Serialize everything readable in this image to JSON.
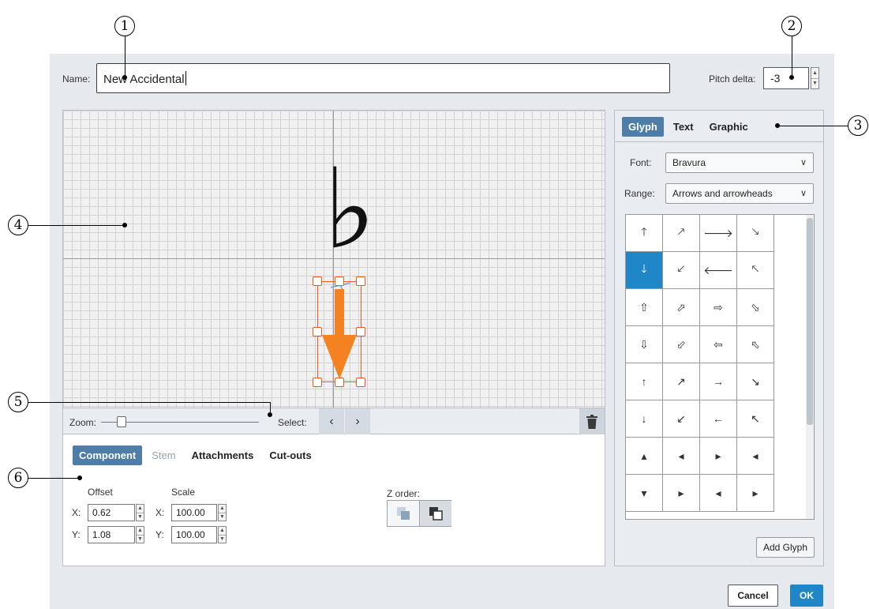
{
  "callouts": [
    "1",
    "2",
    "3",
    "4",
    "5",
    "6"
  ],
  "header": {
    "name_label": "Name:",
    "name_value": "New Accidental",
    "pitch_label": "Pitch delta:",
    "pitch_value": "-3"
  },
  "canvas": {
    "glyph": "♭"
  },
  "zoom_bar": {
    "zoom_label": "Zoom:",
    "select_label": "Select:",
    "prev": "‹",
    "next": "›",
    "trash_icon": "trash-icon"
  },
  "component_tabs": [
    {
      "label": "Component",
      "state": "active"
    },
    {
      "label": "Stem",
      "state": "disabled"
    },
    {
      "label": "Attachments",
      "state": "normal"
    },
    {
      "label": "Cut-outs",
      "state": "normal"
    }
  ],
  "properties": {
    "offset_label": "Offset",
    "scale_label": "Scale",
    "x_label": "X:",
    "y_label": "Y:",
    "offset_x": "0.62",
    "offset_y": "1.08",
    "scale_x": "100.00",
    "scale_y": "100.00",
    "zorder_label": "Z order:"
  },
  "right_tabs": [
    {
      "label": "Glyph",
      "state": "active"
    },
    {
      "label": "Text",
      "state": "normal"
    },
    {
      "label": "Graphic",
      "state": "normal"
    }
  ],
  "font": {
    "label": "Font:",
    "value": "Bravura"
  },
  "range": {
    "label": "Range:",
    "value": "Arrows and arrowheads"
  },
  "glyphs": [
    [
      "🡑",
      "🡕",
      "🡒",
      "🡖"
    ],
    [
      "🡓",
      "🡗",
      "🡐",
      "🡔"
    ],
    [
      "⇧",
      "⬀",
      "⇨",
      "⬂"
    ],
    [
      "⇩",
      "⬃",
      "⇦",
      "⬁"
    ],
    [
      "↑",
      "↗",
      "→",
      "↘"
    ],
    [
      "↓",
      "↙",
      "←",
      "↖"
    ],
    [
      "▴",
      "◂",
      "▸",
      "◂"
    ],
    [
      "▾",
      "▸",
      "◂",
      "▸"
    ]
  ],
  "selected_glyph": [
    1,
    0
  ],
  "buttons": {
    "add_glyph": "Add Glyph",
    "cancel": "Cancel",
    "ok": "OK"
  },
  "colors": {
    "accent": "#4e7ea8",
    "selection": "#1f86c8",
    "handle": "#f05a1e",
    "arrow": "#f58220"
  }
}
